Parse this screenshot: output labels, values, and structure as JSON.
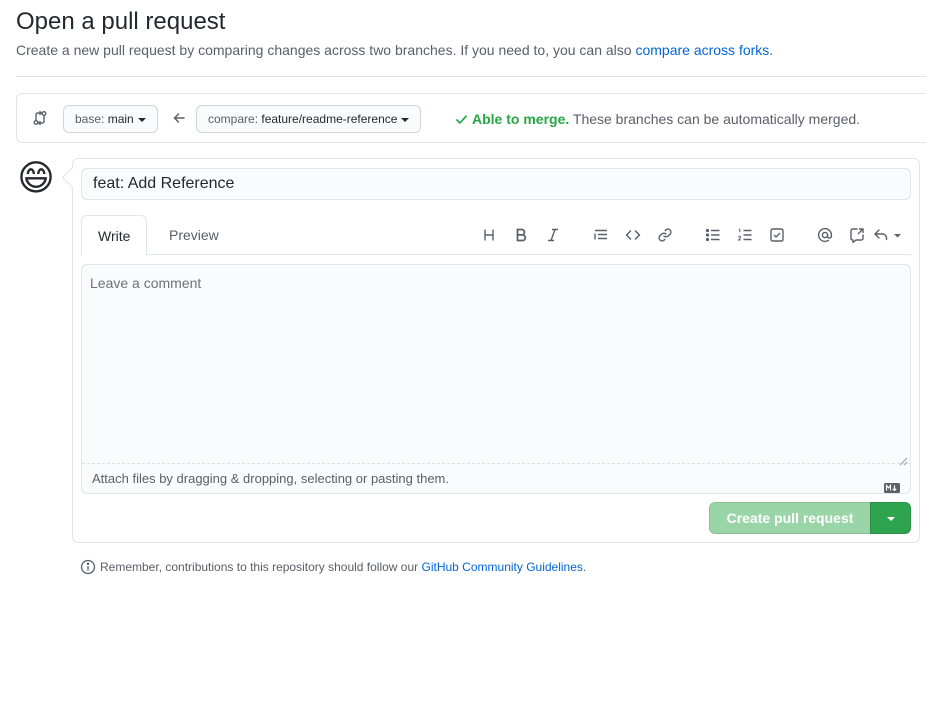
{
  "header": {
    "title": "Open a pull request",
    "subtitle_text": "Create a new pull request by comparing changes across two branches. If you need to, you can also ",
    "subtitle_link": "compare across forks",
    "subtitle_end": "."
  },
  "range": {
    "base_prefix": "base: ",
    "base_branch": "main",
    "compare_prefix": "compare: ",
    "compare_branch": "feature/readme-reference",
    "merge_ok": "Able to merge.",
    "merge_detail": " These branches can be automatically merged."
  },
  "composer": {
    "avatar": "😄",
    "title_value": "feat: Add Reference",
    "tabs": [
      {
        "label": "Write"
      },
      {
        "label": "Preview"
      }
    ],
    "comment_placeholder": "Leave a comment",
    "attach_text": "Attach files by dragging & dropping, selecting or pasting them.",
    "submit_label": "Create pull request"
  },
  "colors": {
    "accent_link": "#0366d6",
    "success": "#28a745",
    "button_disabled": "#94d3a2",
    "button_green": "#2ea44f"
  },
  "footer": {
    "note_text": "Remember, contributions to this repository should follow our ",
    "note_link": "GitHub Community Guidelines",
    "note_end": "."
  }
}
